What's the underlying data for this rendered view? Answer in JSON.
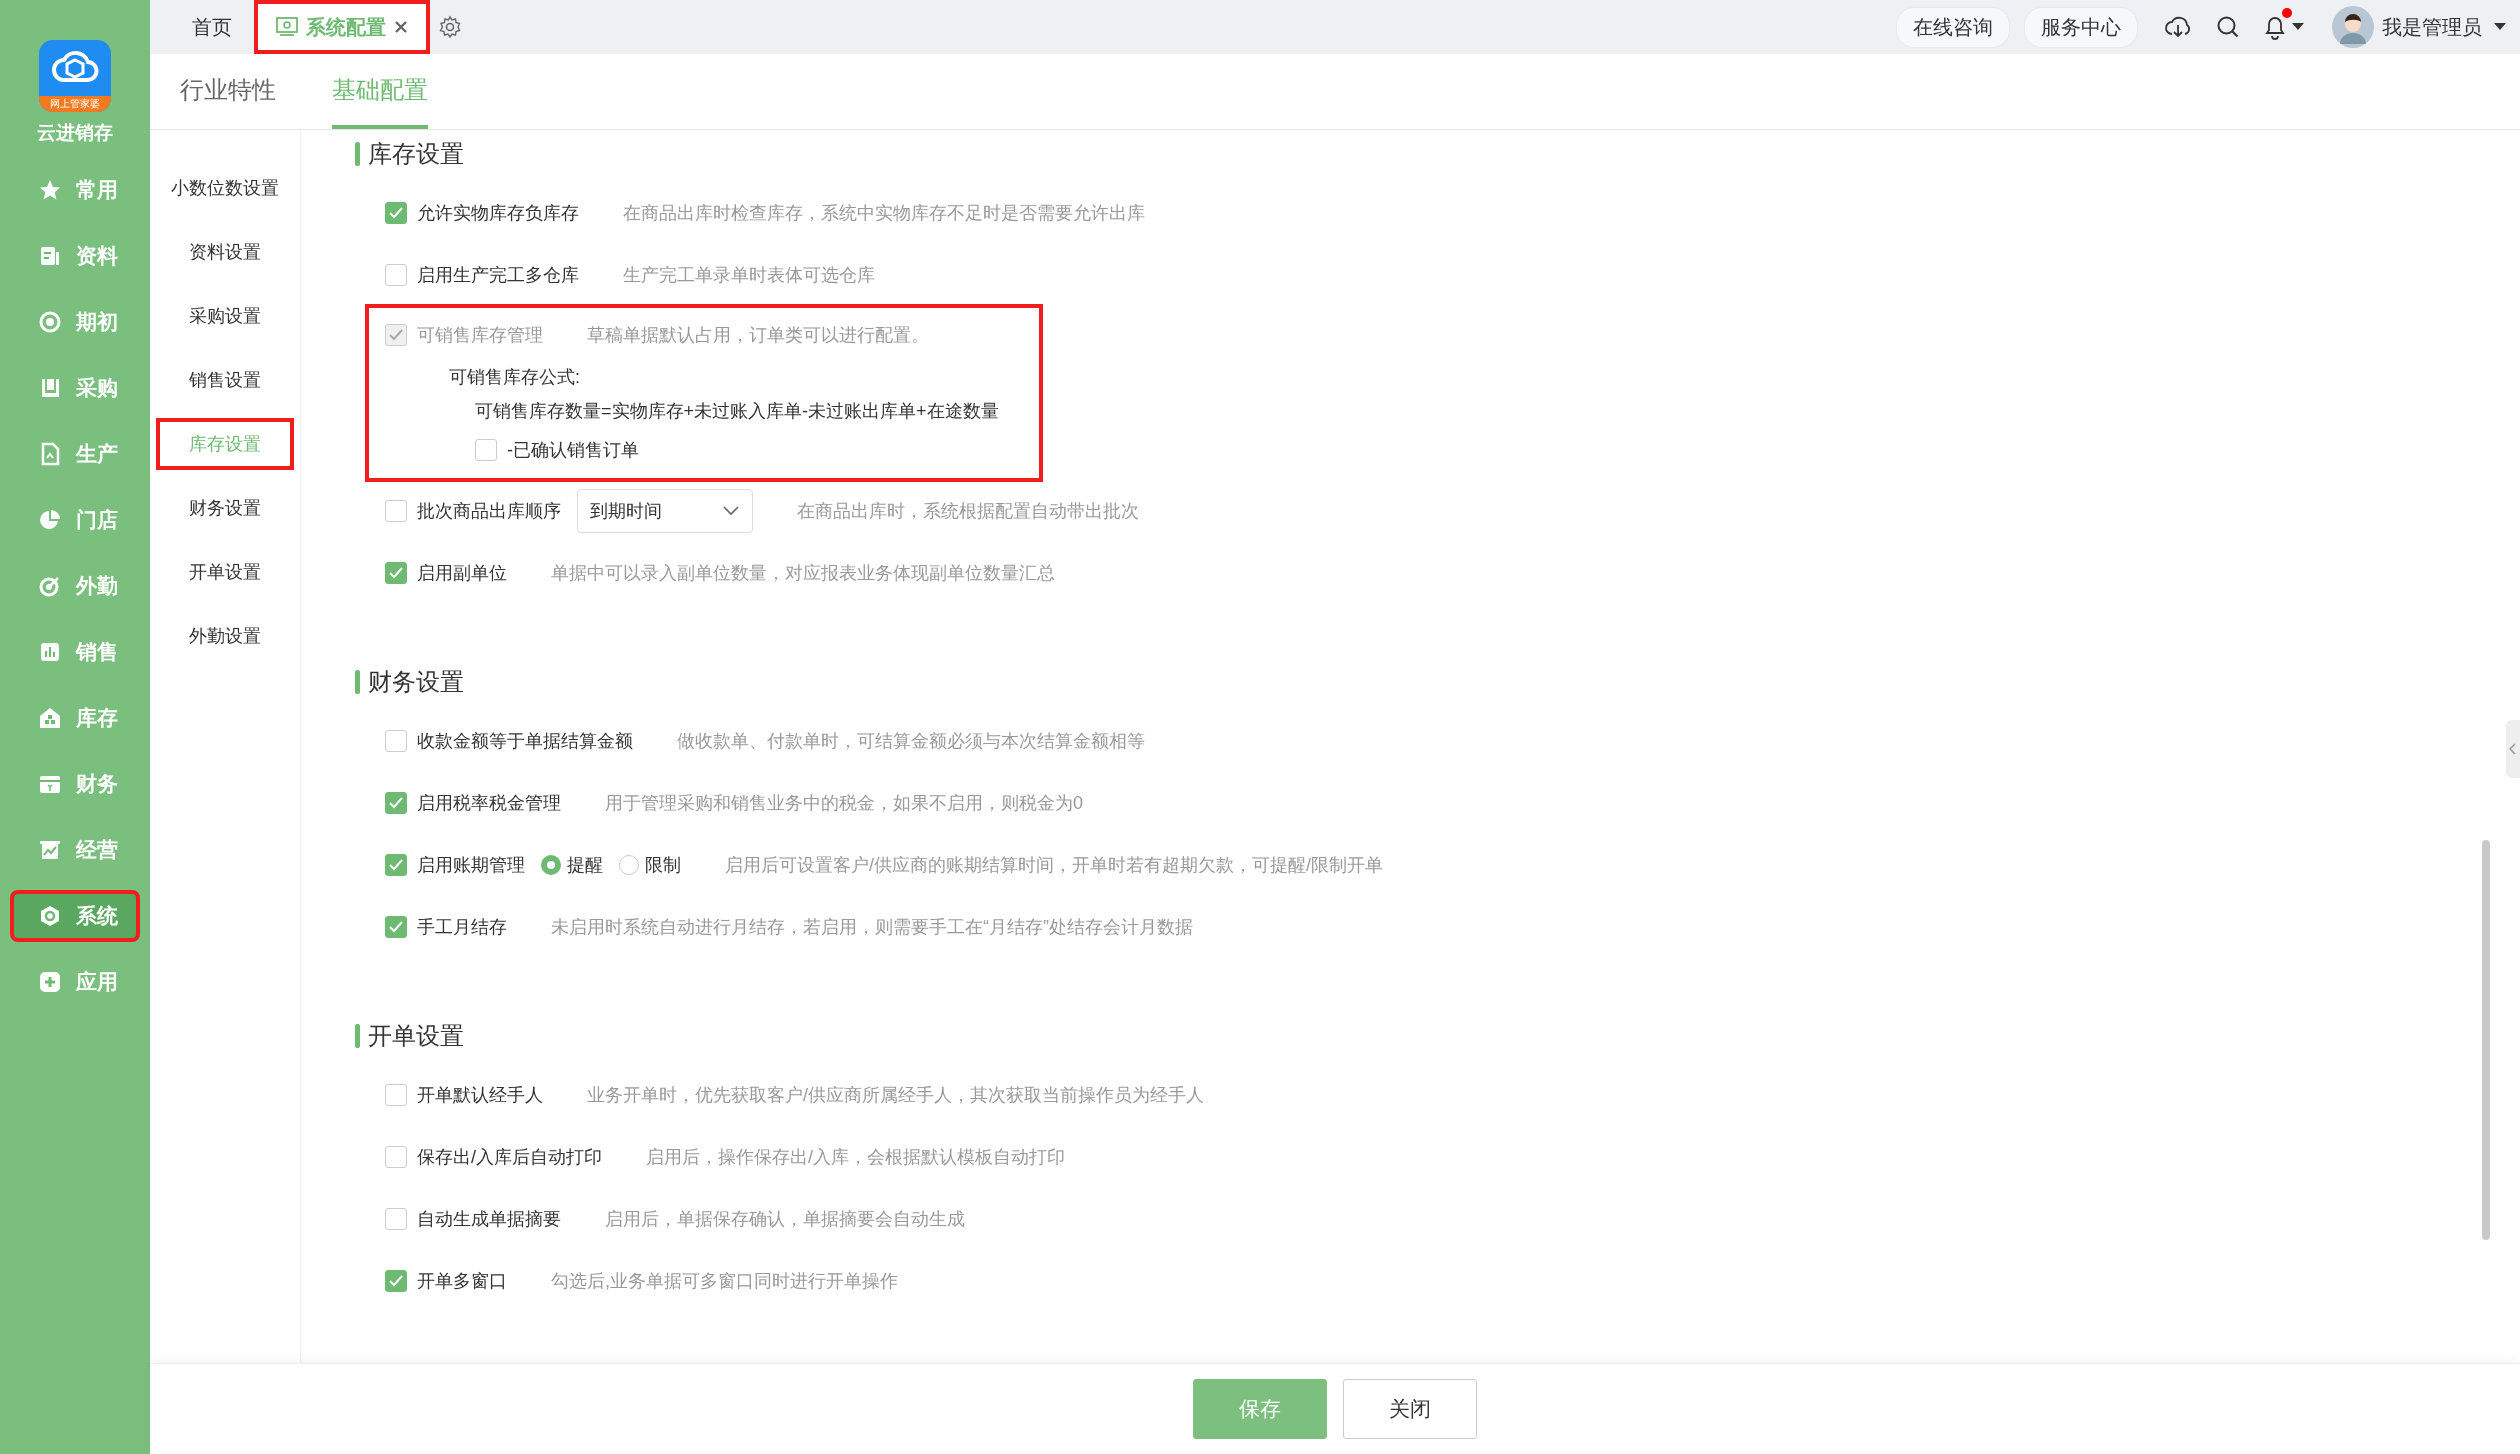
{
  "sidebar": {
    "logo_caption": "网上管家婆",
    "app_name": "云进销存",
    "items": [
      {
        "label": "常用",
        "selected": false,
        "highlighted": false
      },
      {
        "label": "资料",
        "selected": false,
        "highlighted": false
      },
      {
        "label": "期初",
        "selected": false,
        "highlighted": false
      },
      {
        "label": "采购",
        "selected": false,
        "highlighted": false
      },
      {
        "label": "生产",
        "selected": false,
        "highlighted": false
      },
      {
        "label": "门店",
        "selected": false,
        "highlighted": false
      },
      {
        "label": "外勤",
        "selected": false,
        "highlighted": false
      },
      {
        "label": "销售",
        "selected": false,
        "highlighted": false
      },
      {
        "label": "库存",
        "selected": false,
        "highlighted": false
      },
      {
        "label": "财务",
        "selected": false,
        "highlighted": false
      },
      {
        "label": "经营",
        "selected": false,
        "highlighted": false
      },
      {
        "label": "系统",
        "selected": true,
        "highlighted": true
      },
      {
        "label": "应用",
        "selected": false,
        "highlighted": false
      }
    ]
  },
  "top_tabs": [
    {
      "label": "首页",
      "kind": "home",
      "selected": false,
      "closable": false,
      "highlighted": false
    },
    {
      "label": "系统配置",
      "kind": "page",
      "selected": true,
      "closable": true,
      "highlighted": true
    }
  ],
  "header": {
    "buttons": [
      "在线咨询",
      "服务中心"
    ],
    "has_notification": true,
    "user": "我是管理员"
  },
  "sub_tabs": [
    {
      "label": "行业特性",
      "selected": false
    },
    {
      "label": "基础配置",
      "selected": true
    }
  ],
  "settings_nav": [
    {
      "label": "小数位数设置",
      "selected": false,
      "highlighted": false
    },
    {
      "label": "资料设置",
      "selected": false,
      "highlighted": false
    },
    {
      "label": "采购设置",
      "selected": false,
      "highlighted": false
    },
    {
      "label": "销售设置",
      "selected": false,
      "highlighted": false
    },
    {
      "label": "库存设置",
      "selected": true,
      "highlighted": true
    },
    {
      "label": "财务设置",
      "selected": false,
      "highlighted": false
    },
    {
      "label": "开单设置",
      "selected": false,
      "highlighted": false
    },
    {
      "label": "外勤设置",
      "selected": false,
      "highlighted": false
    }
  ],
  "sections": [
    {
      "title": "库存设置",
      "rows": [
        {
          "kind": "checkbox",
          "label": "允许实物库存负库存",
          "checked": true,
          "disabled": false,
          "description": "在商品出库时检查库存，系统中实物库存不足时是否需要允许出库"
        },
        {
          "kind": "checkbox",
          "label": "启用生产完工多仓库",
          "checked": false,
          "disabled": false,
          "description": "生产完工单录单时表体可选仓库"
        },
        {
          "kind": "formula_group",
          "highlighted": true,
          "label": "可销售库存管理",
          "checked": true,
          "disabled": true,
          "description": "草稿单据默认占用，订单类可以进行配置。",
          "formula_title": "可销售库存公式:",
          "formula": "可销售库存数量=实物库存+未过账入库单-未过账出库单+在途数量",
          "sub_option": {
            "label": "-已确认销售订单",
            "checked": false
          }
        },
        {
          "kind": "checkbox_select",
          "label": "批次商品出库顺序",
          "checked": false,
          "disabled": false,
          "select_value": "到期时间",
          "description": "在商品出库时，系统根据配置自动带出批次"
        },
        {
          "kind": "checkbox",
          "label": "启用副单位",
          "checked": true,
          "disabled": false,
          "description": "单据中可以录入副单位数量，对应报表业务体现副单位数量汇总"
        }
      ]
    },
    {
      "title": "财务设置",
      "rows": [
        {
          "kind": "checkbox",
          "label": "收款金额等于单据结算金额",
          "checked": false,
          "disabled": false,
          "description": "做收款单、付款单时，可结算金额必须与本次结算金额相等"
        },
        {
          "kind": "checkbox",
          "label": "启用税率税金管理",
          "checked": true,
          "disabled": false,
          "description": "用于管理采购和销售业务中的税金，如果不启用，则税金为0"
        },
        {
          "kind": "checkbox_radio",
          "label": "启用账期管理",
          "checked": true,
          "disabled": false,
          "options": [
            {
              "label": "提醒",
              "selected": true
            },
            {
              "label": "限制",
              "selected": false
            }
          ],
          "description": "启用后可设置客户/供应商的账期结算时间，开单时若有超期欠款，可提醒/限制开单"
        },
        {
          "kind": "checkbox",
          "label": "手工月结存",
          "checked": true,
          "disabled": false,
          "description": "未启用时系统自动进行月结存，若启用，则需要手工在“月结存”处结存会计月数据"
        }
      ]
    },
    {
      "title": "开单设置",
      "rows": [
        {
          "kind": "checkbox",
          "label": "开单默认经手人",
          "checked": false,
          "disabled": false,
          "description": "业务开单时，优先获取客户/供应商所属经手人，其次获取当前操作员为经手人"
        },
        {
          "kind": "checkbox",
          "label": "保存出/入库后自动打印",
          "checked": false,
          "disabled": false,
          "description": "启用后，操作保存出/入库，会根据默认模板自动打印"
        },
        {
          "kind": "checkbox",
          "label": "自动生成单据摘要",
          "checked": false,
          "disabled": false,
          "description": "启用后，单据保存确认，单据摘要会自动生成"
        },
        {
          "kind": "checkbox",
          "label": "开单多窗口",
          "checked": true,
          "disabled": false,
          "description": "勾选后,业务单据可多窗口同时进行开单操作"
        }
      ]
    }
  ],
  "footer": {
    "buttons": [
      {
        "label": "保存",
        "kind": "primary"
      },
      {
        "label": "关闭",
        "kind": "default"
      }
    ]
  }
}
